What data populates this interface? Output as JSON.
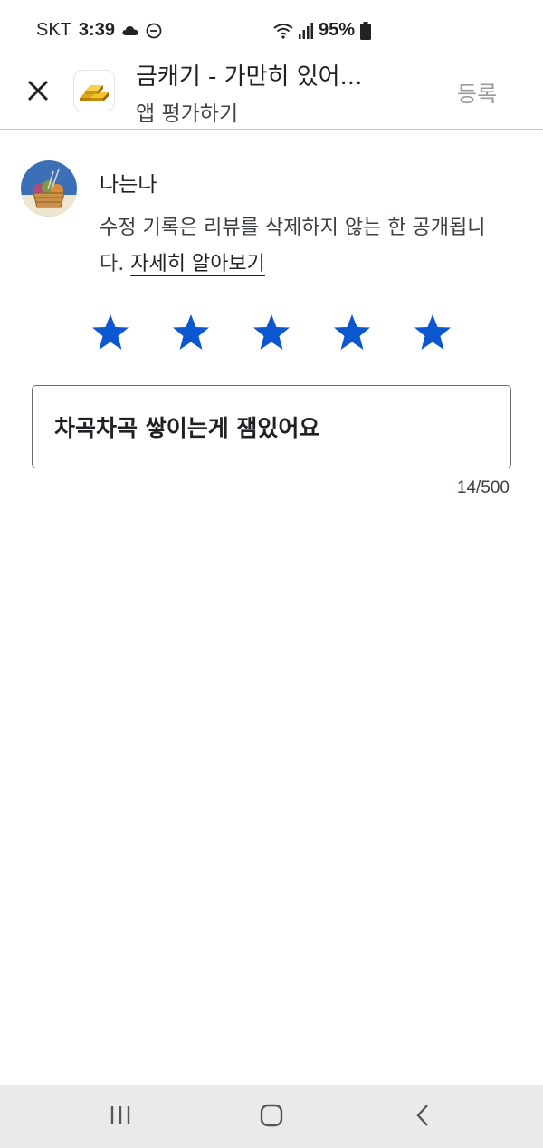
{
  "status_bar": {
    "carrier": "SKT",
    "time": "3:39",
    "battery_percent": "95%",
    "icons": [
      "cloud-icon",
      "dnd-icon",
      "wifi-icon",
      "signal-icon",
      "battery-icon"
    ]
  },
  "app_bar": {
    "title": "금캐기 - 가만히 있어...",
    "subtitle": "앱 평가하기",
    "submit_label": "등록",
    "close_icon": "close-icon",
    "app_icon": "gold-bars-icon"
  },
  "profile": {
    "user_name": "나는나",
    "notice_text": "수정 기록은 리뷰를 삭제하지 않는 한 공개됩니다. ",
    "learn_more": "자세히 알아보기"
  },
  "rating": {
    "value": 5,
    "max": 5,
    "star_color": "#0b57d0"
  },
  "review": {
    "text": "차곡차곡 쌓이는게 잼있어요",
    "counter": "14/500"
  },
  "nav_bar": {
    "icons": [
      "recent-apps-icon",
      "home-icon",
      "back-icon"
    ]
  }
}
